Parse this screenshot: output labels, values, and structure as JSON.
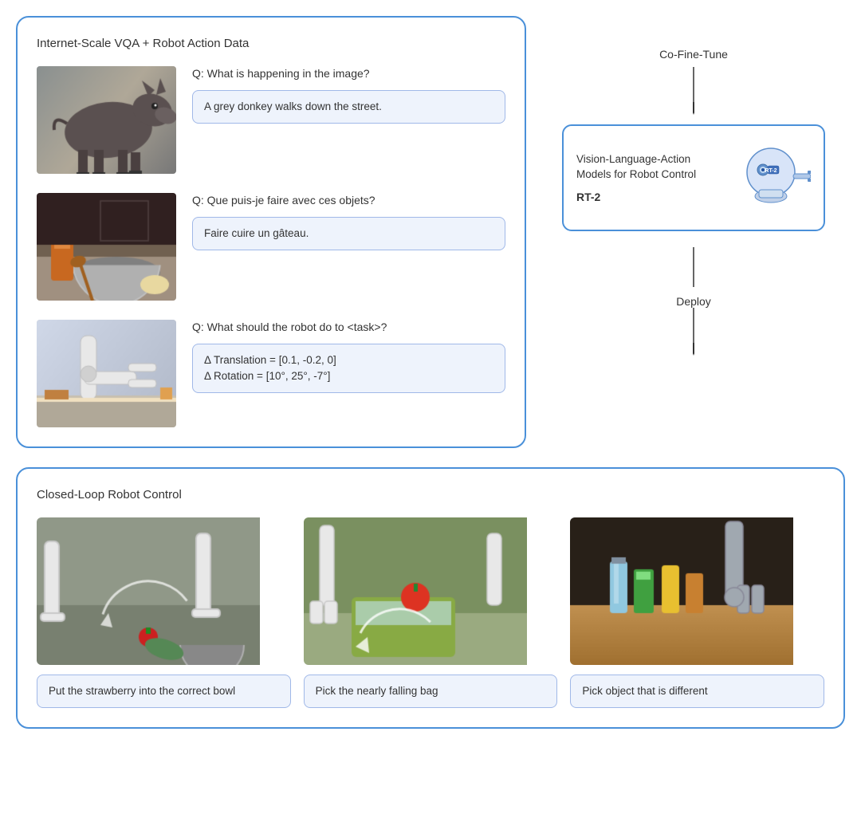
{
  "top_left_panel": {
    "title": "Internet-Scale VQA + Robot Action Data",
    "qa_items": [
      {
        "question": "Q: What is happening in the image?",
        "answer": "A grey donkey walks down the street.",
        "image_type": "donkey"
      },
      {
        "question": "Q: Que puis-je faire avec ces objets?",
        "answer": "Faire cuire un gâteau.",
        "image_type": "kitchen"
      },
      {
        "question": "Q: What should the robot do to <task>?",
        "answer": "Δ Translation = [0.1, -0.2, 0]\nΔ Rotation = [10°, 25°, -7°]",
        "image_type": "robot_arm"
      }
    ]
  },
  "connector": {
    "co_fine_tune_label": "Co-Fine-Tune",
    "deploy_label": "Deploy"
  },
  "vla_box": {
    "title": "Vision-Language-Action Models for Robot Control",
    "subtitle": "RT-2"
  },
  "bottom_panel": {
    "title": "Closed-Loop Robot Control",
    "cards": [
      {
        "caption": "Put the strawberry into the correct bowl",
        "image_type": "strawberry"
      },
      {
        "caption": "Pick the nearly falling bag",
        "image_type": "bag"
      },
      {
        "caption": "Pick object that is different",
        "image_type": "bottles"
      }
    ]
  }
}
